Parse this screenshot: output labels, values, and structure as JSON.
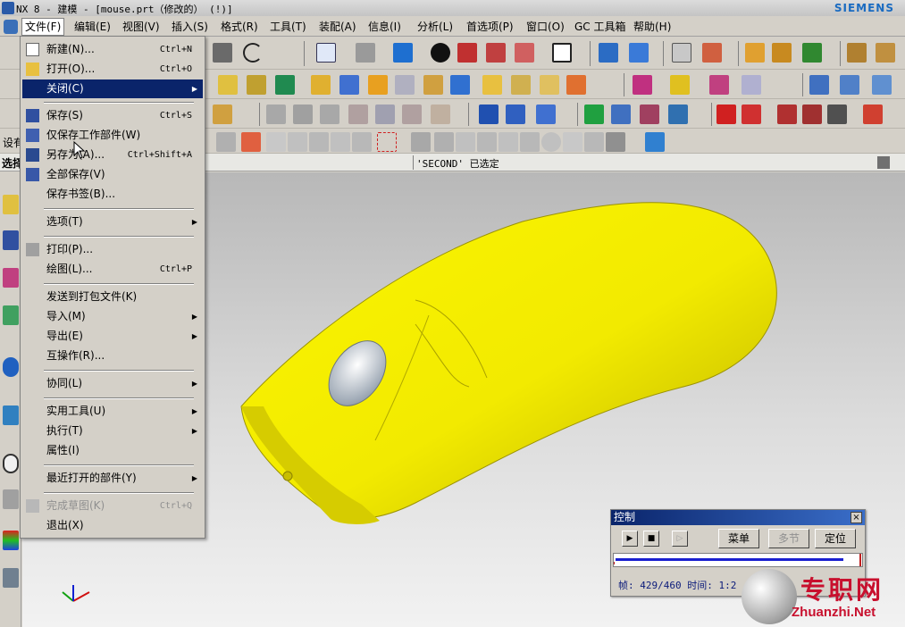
{
  "window": {
    "title": "NX 8 - 建模 - [mouse.prt（修改的）   (!)]",
    "brand": "SIEMENS"
  },
  "menubar": {
    "items": [
      {
        "label": "文件(F)"
      },
      {
        "label": "编辑(E)"
      },
      {
        "label": "视图(V)"
      },
      {
        "label": "插入(S)"
      },
      {
        "label": "格式(R)"
      },
      {
        "label": "工具(T)"
      },
      {
        "label": "装配(A)"
      },
      {
        "label": "信息(I)"
      },
      {
        "label": "分析(L)"
      },
      {
        "label": "首选项(P)"
      },
      {
        "label": "窗口(O)"
      },
      {
        "label": "GC 工具箱"
      },
      {
        "label": "帮助(H)"
      }
    ]
  },
  "file_menu": {
    "items": [
      {
        "label": "新建(N)...",
        "shortcut": "Ctrl+N",
        "icon": "new-file-icon"
      },
      {
        "label": "打开(O)...",
        "shortcut": "Ctrl+O",
        "icon": "open-folder-icon"
      },
      {
        "label": "关闭(C)",
        "submenu": true,
        "highlighted": true
      },
      {
        "label": "保存(S)",
        "shortcut": "Ctrl+S",
        "icon": "save-icon"
      },
      {
        "label": "仅保存工作部件(W)",
        "icon": "save-work-part-icon"
      },
      {
        "label": "另存为(A)...",
        "shortcut": "Ctrl+Shift+A",
        "icon": "save-as-icon"
      },
      {
        "label": "全部保存(V)",
        "icon": "save-all-icon"
      },
      {
        "label": "保存书签(B)..."
      },
      {
        "label": "选项(T)",
        "submenu": true
      },
      {
        "label": "打印(P)...",
        "icon": "print-icon"
      },
      {
        "label": "绘图(L)...",
        "shortcut": "Ctrl+P"
      },
      {
        "label": "发送到打包文件(K)"
      },
      {
        "label": "导入(M)",
        "submenu": true
      },
      {
        "label": "导出(E)",
        "submenu": true
      },
      {
        "label": "互操作(R)..."
      },
      {
        "label": "协同(L)",
        "submenu": true
      },
      {
        "label": "实用工具(U)",
        "submenu": true
      },
      {
        "label": "执行(T)",
        "submenu": true
      },
      {
        "label": "属性(I)"
      },
      {
        "label": "最近打开的部件(Y)",
        "submenu": true
      },
      {
        "label": "完成草图(K)",
        "shortcut": "Ctrl+Q",
        "disabled": true,
        "icon": "finish-sketch-icon"
      },
      {
        "label": "退出(X)"
      }
    ],
    "submenu_arrow": "▶"
  },
  "status": {
    "selection_label": "选择",
    "selected_text": "'SECOND' 已选定"
  },
  "toolbar_partial": {
    "row4_label": "设有"
  },
  "control_dialog": {
    "title": "控制",
    "close_label": "×",
    "play_label": "▶",
    "stop_label": "■",
    "step_label": "▷",
    "menu_label": "菜单",
    "multi_section_label": "多节",
    "position_label": "定位",
    "frame_text": "帧: 429/460 时间: 1:2",
    "progress": 0.93
  },
  "watermark": {
    "cn": "专职网",
    "en": "Zhuanzhi.Net"
  },
  "colors": {
    "model": "#f2ea00",
    "highlight": "#0a246a",
    "track": "#1a20d0",
    "watermark": "#c8102e"
  }
}
